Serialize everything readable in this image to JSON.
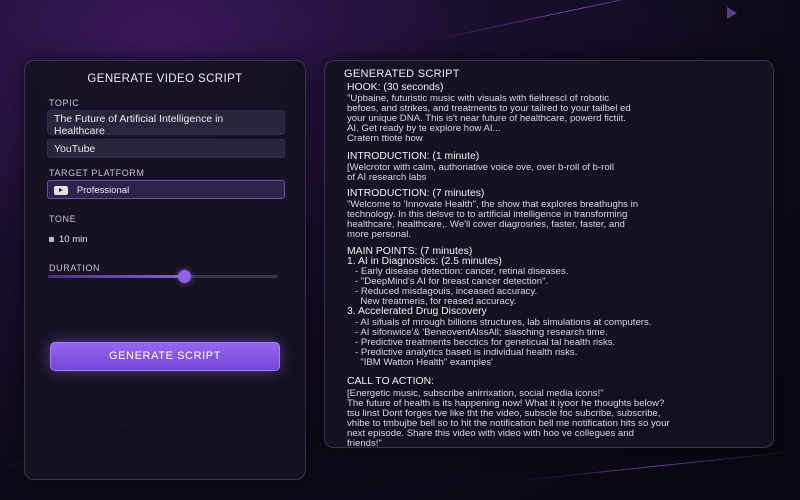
{
  "left_panel": {
    "title": "GENERATE VIDEO SCRIPT",
    "topic_label": "TOPIC",
    "topic_line1": "The Future of Artificial Intelligence in",
    "topic_line2": "Healthcare",
    "topic_secondary": "YouTube",
    "platform_label": "TARGET PLATFORM",
    "platform_value": "Professional",
    "tone_label": "TONE",
    "tone_value": "10 min",
    "duration_label": "DURATION",
    "duration_fraction": 0.59,
    "generate_button": "GENERATE SCRIPT"
  },
  "right_panel": {
    "title": "GENERATED SCRIPT",
    "lines": [
      {
        "t": "HOOK: (30 seconds)",
        "h": true
      },
      {
        "t": "\"Upbaine, futuristic music with visuals with fieihrescl of robotic",
        "h": false
      },
      {
        "t": "befoes, and strikes, and treatments to your tailred to your tailbel ed",
        "h": false
      },
      {
        "t": "your unique DNA. This is't near future of healthcare, powerd fictiit.",
        "h": false
      },
      {
        "t": "AI. Get ready by te explore how AI...",
        "h": false
      },
      {
        "t": "Cratern ttiote how",
        "h": false
      },
      {
        "t": "INTRODUCTION: (1 minute)",
        "h": true
      },
      {
        "t": "[Welcrotor with calm, authoriative voice ove, over b-roll of b-roll",
        "h": false
      },
      {
        "t": "of AI research labs",
        "h": false
      },
      {
        "t": "INTRODUCTION: (7 minutes)",
        "h": true
      },
      {
        "t": "\"Welcome to 'Innovate Health\", the show that explores breathughs in",
        "h": false
      },
      {
        "t": "technology. In this delsve to to artificial intelligence in transforming",
        "h": false
      },
      {
        "t": "healthcare, healthcare,. We'll cover diagrosries, faster, faster, and",
        "h": false
      },
      {
        "t": "more personal.",
        "h": false
      },
      {
        "t": "MAIN POINTS: (7 minutes)",
        "h": true
      },
      {
        "t": "1. AI in Diagnostics: (2.5 minutes)",
        "h": true
      },
      {
        "t": "   - Early disease detection: cancer, retinal diseases.",
        "h": false
      },
      {
        "t": "   - \"DeepMind's AI for breast cancer detection\".",
        "h": false
      },
      {
        "t": "   - Reduced misdagouis, inceased accuracy.",
        "h": false
      },
      {
        "t": "     New treatmeris, for reased accuracy.",
        "h": false
      },
      {
        "t": "3. Accelerated Drug Discovery",
        "h": true
      },
      {
        "t": "   - AI sifuals of mrough billions structures, lab simulations at computers.",
        "h": false
      },
      {
        "t": "   - AI sifonwice'& 'BeneoventAlssAll; slasching research time.",
        "h": false
      },
      {
        "t": "   - Predictive treatments becctics for geneticual tal health risks.",
        "h": false
      },
      {
        "t": "   - Predictive analytics baseti is individual health risks.",
        "h": false
      },
      {
        "t": "     \"IBM Watton Health\" examples'",
        "h": false
      },
      {
        "t": "CALL TO ACTION:",
        "h": true
      },
      {
        "t": "[Energetic music, subscribe anirrixation, social media icons!\"",
        "h": false
      },
      {
        "t": "The future of health is its happening now! What it iyoor he thoughts below?",
        "h": false
      },
      {
        "t": "tsu linst Dont forges tve like tht the video, subscle foc subcribe, subscribe,",
        "h": false
      },
      {
        "t": "vhibe to tmbujbe bell so to hit the notification bell me notification hits so your",
        "h": false
      },
      {
        "t": "next episode. Share this video with video with hoo ve collegues and",
        "h": false
      },
      {
        "t": "friends!\"",
        "h": false
      }
    ]
  },
  "colors": {
    "accent": "#8c63e6",
    "panel_bg": "#161221",
    "page_bg": "#0d0a17"
  },
  "icons": {
    "platform_icon": "youtube-icon",
    "tone_icon": "speaker-icon"
  }
}
